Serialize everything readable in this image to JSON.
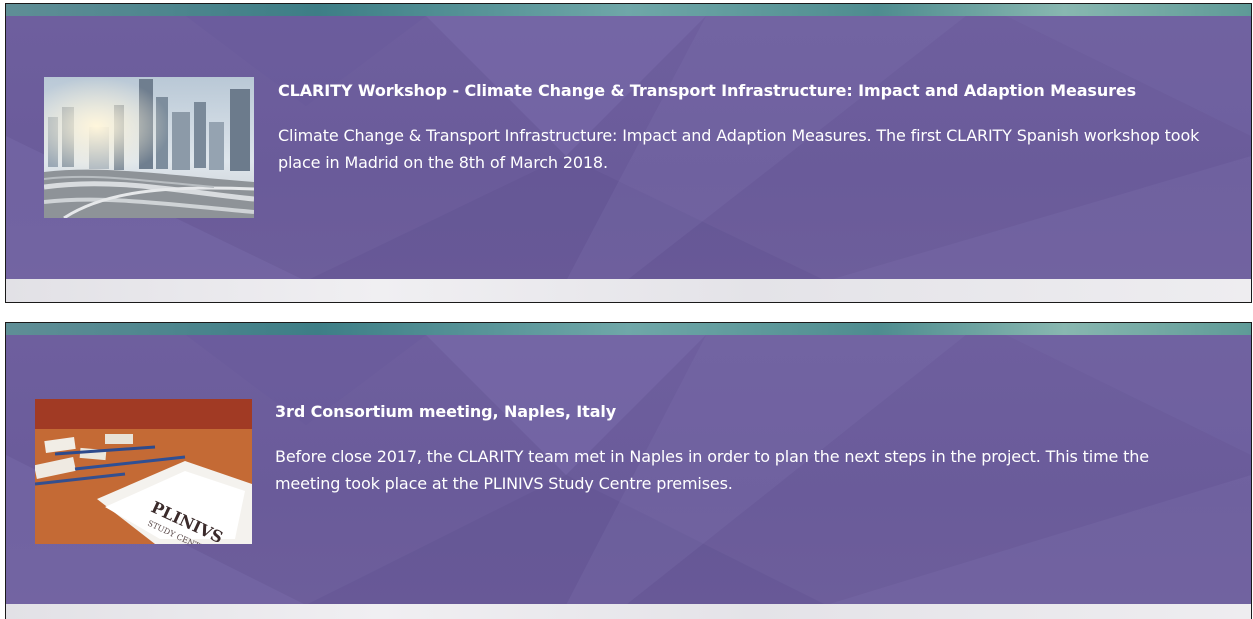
{
  "news": [
    {
      "title": "CLARITY Workshop - Climate Change & Transport Infrastructure: Impact and Adaption Measures",
      "description": "Climate Change & Transport Infrastructure: Impact and Adaption Measures. The first CLARITY Spanish workshop took place in Madrid on the 8th of March 2018.",
      "image": "city-highway-image"
    },
    {
      "title": "3rd Consortium meeting, Naples, Italy",
      "description": "Before close 2017, the CLARITY team met in Naples in order to plan the next steps in the project. This time the meeting took place at the PLINIVS Study Centre premises.",
      "image": "meeting-documents-image"
    }
  ],
  "colors": {
    "card_purple": "#6e5f9e",
    "teal_strip": "#3d7e86",
    "text": "#ffffff"
  }
}
